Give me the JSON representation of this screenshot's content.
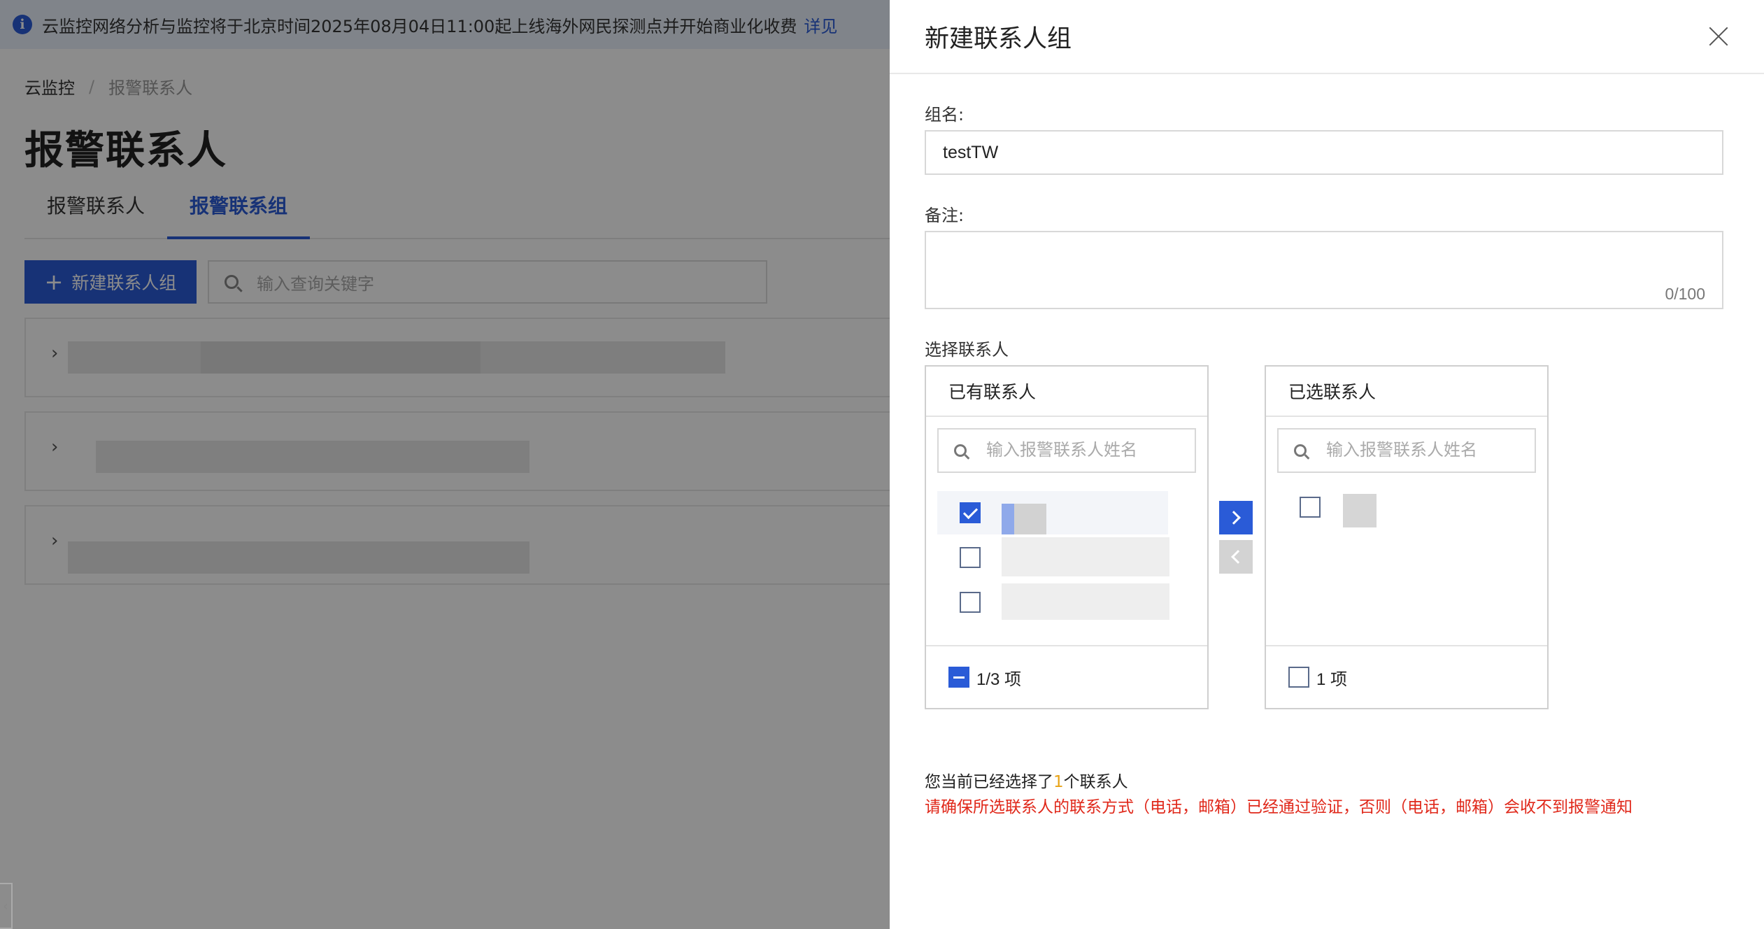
{
  "notice": {
    "text": "云监控网络分析与监控将于北京时间2025年08月04日11:00起上线海外网民探测点并开始商业化收费",
    "link": "详见"
  },
  "breadcrumb": {
    "root": "云监控",
    "separator": "/",
    "current": "报警联系人"
  },
  "page_title": "报警联系人",
  "tabs": [
    {
      "label": "报警联系人",
      "active": false
    },
    {
      "label": "报警联系组",
      "active": true
    }
  ],
  "toolbar": {
    "new_group_label": "新建联系人组",
    "search_placeholder": "输入查询关键字"
  },
  "drawer": {
    "title": "新建联系人组",
    "group_name_label": "组名:",
    "group_name_value": "testTW",
    "remark_label": "备注:",
    "remark_value": "",
    "remark_counter": "0/100",
    "select_contacts_label": "选择联系人",
    "available": {
      "title": "已有联系人",
      "search_placeholder": "输入报警联系人姓名",
      "items": [
        {
          "checked": true
        },
        {
          "checked": false
        },
        {
          "checked": false
        }
      ],
      "footer": "1/3 项",
      "footer_state": "indeterminate"
    },
    "selected": {
      "title": "已选联系人",
      "search_placeholder": "输入报警联系人姓名",
      "items": [
        {
          "checked": false
        }
      ],
      "footer": "1 项",
      "footer_state": "unchecked"
    },
    "summary_prefix": "您当前已经选择了",
    "summary_count": "1",
    "summary_suffix": "个联系人",
    "warning": "请确保所选联系人的联系方式（电话，邮箱）已经通过验证，否则（电话，邮箱）会收不到报警通知"
  },
  "colors": {
    "primary": "#2a5bd7",
    "warning_text": "#e0281a",
    "count_highlight": "#e8a317"
  }
}
